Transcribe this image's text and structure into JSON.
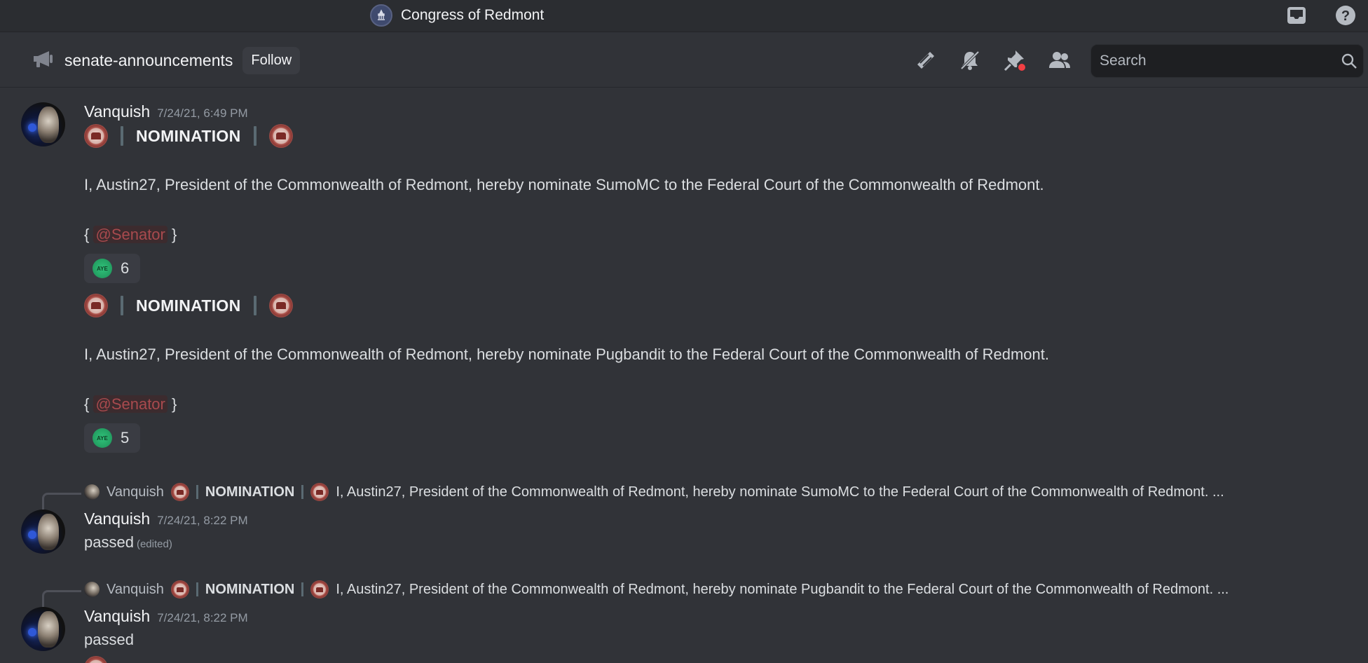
{
  "topbar": {
    "server_name": "Congress of Redmont",
    "inbox_icon": "inbox-icon",
    "help_icon": "help-icon"
  },
  "channel": {
    "icon": "megaphone-icon",
    "name": "senate-announcements",
    "follow_label": "Follow",
    "header_icons": [
      "threads-icon",
      "bell-muted-icon",
      "pin-icon",
      "members-icon"
    ],
    "search_placeholder": "Search"
  },
  "messages": [
    {
      "author": "Vanquish",
      "timestamp": "7/24/21, 6:49 PM",
      "blocks": [
        {
          "heading": "NOMINATION",
          "body": "I, Austin27, President of the Commonwealth of Redmont, hereby nominate SumoMC to the Federal Court of the Commonwealth of Redmont.",
          "open_brace": "{",
          "mention": "@Senator",
          "close_brace": "}",
          "reaction": {
            "emoji": "AYE",
            "count": "6"
          }
        },
        {
          "heading": "NOMINATION",
          "body": "I, Austin27, President of the Commonwealth of Redmont, hereby nominate Pugbandit to the Federal Court of the Commonwealth of Redmont.",
          "open_brace": "{",
          "mention": "@Senator",
          "close_brace": "}",
          "reaction": {
            "emoji": "AYE",
            "count": "5"
          }
        }
      ]
    },
    {
      "reply": {
        "author": "Vanquish",
        "heading": "NOMINATION",
        "snippet": "I, Austin27, President of the Commonwealth of Redmont, hereby nominate SumoMC to the Federal Court of the Commonwealth of Redmont.  ..."
      },
      "author": "Vanquish",
      "timestamp": "7/24/21, 8:22 PM",
      "text": "passed",
      "edited_label": "(edited)"
    },
    {
      "reply": {
        "author": "Vanquish",
        "heading": "NOMINATION",
        "snippet": "I, Austin27, President of the Commonwealth of Redmont, hereby nominate Pugbandit to the Federal Court of the Commonwealth of Redmont. ..."
      },
      "author": "Vanquish",
      "timestamp": "7/24/21, 8:22 PM",
      "text": "passed"
    }
  ],
  "colors": {
    "background": "#313338",
    "topbar": "#2b2d31",
    "mention_text": "#a84a4e",
    "reaction_bg": "#3a3c43",
    "aye_green": "#30c27a"
  }
}
